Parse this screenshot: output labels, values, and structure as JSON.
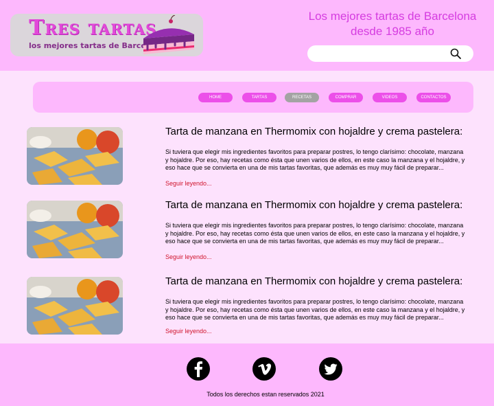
{
  "header": {
    "logo_title": "Tres tartas",
    "logo_subtitle": "los mejores tartas de Barcelona",
    "tagline_line1": "Los mejores tartas de Barcelona",
    "tagline_line2": "desde 1985 año",
    "search_placeholder": ""
  },
  "nav": {
    "items": [
      {
        "label": "HOME"
      },
      {
        "label": "TARTAS"
      },
      {
        "label": "RECETAS",
        "active": true
      },
      {
        "label": "COMPRAR"
      },
      {
        "label": "VIDEOS"
      },
      {
        "label": "CONTACTOS"
      }
    ]
  },
  "articles": [
    {
      "title": "Tarta de manzana en Thermomix con hojaldre y crema pastelera:",
      "text": "Si tuviera que elegir mis ingredientes favoritos para preparar postres, lo tengo clarísimo: chocolate, manzana y hojaldre. Por eso, hay recetas como ésta que unen varios de ellos, en este caso la manzana y el hojaldre, y eso hace que se convierta en una de mis tartas favoritas, que además es muy muy fácil de preparar...",
      "more": "Seguir leyendo..."
    },
    {
      "title": "Tarta de manzana en Thermomix con hojaldre y crema pastelera:",
      "text": "Si tuviera que elegir mis ingredientes favoritos para preparar postres, lo tengo clarísimo: chocolate, manzana y hojaldre. Por eso, hay recetas como ésta que unen varios de ellos, en este caso la manzana y el hojaldre, y eso hace que se convierta en una de mis tartas favoritas, que además es muy muy fácil de preparar...",
      "more": "Seguir leyendo..."
    },
    {
      "title": "Tarta de manzana en Thermomix con hojaldre y crema pastelera:",
      "text": "Si tuviera que elegir mis ingredientes favoritos para preparar postres, lo tengo clarísimo: chocolate, manzana y hojaldre. Por eso, hay recetas como ésta que unen varios de ellos, en este caso la manzana y el hojaldre, y eso hace que se convierta en una de mis tartas favoritas, que además es muy muy fácil de preparar...",
      "more": "Seguir leyendo..."
    }
  ],
  "footer": {
    "social": [
      "facebook-icon",
      "vimeo-icon",
      "twitter-icon"
    ],
    "copyright": "Todos los derechos estan reservados 2021"
  },
  "colors": {
    "header_bg": "#fdb8fd",
    "page_bg": "#fde2fd",
    "nav_button": "#ec4fe9",
    "nav_active": "#a3a3a3",
    "link": "#d0142c",
    "accent_text": "#d53de0"
  }
}
